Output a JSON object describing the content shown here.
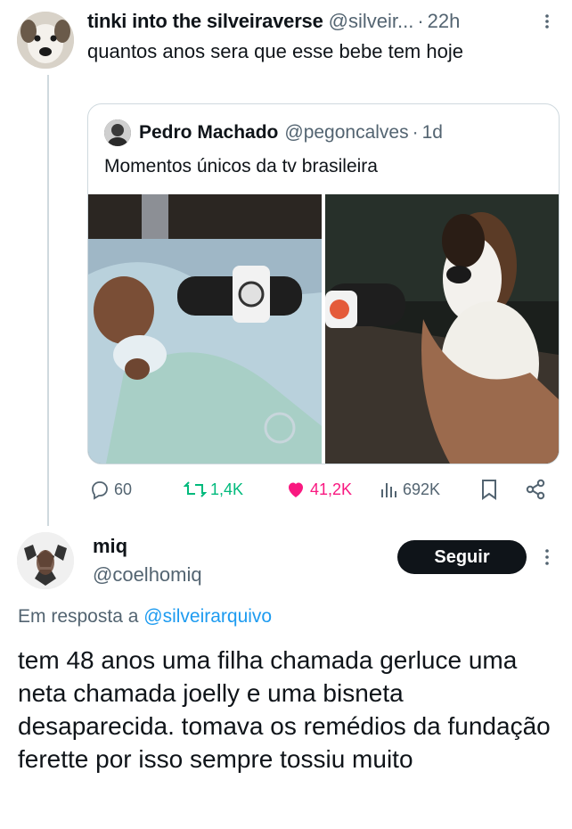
{
  "parent_tweet": {
    "display_name": "tinki into the silveiraverse",
    "handle": "@silveir...",
    "separator": "·",
    "time": "22h",
    "text": "quantos anos sera que esse bebe tem hoje",
    "quote": {
      "display_name": "Pedro Machado",
      "handle": "@pegoncalves",
      "separator": "·",
      "time": "1d",
      "text": "Momentos únicos da tv brasileira"
    },
    "actions": {
      "replies": "60",
      "reposts": "1,4K",
      "likes": "41,2K",
      "views": "692K"
    }
  },
  "reply_tweet": {
    "display_name": "miq",
    "handle": "@coelhomiq",
    "follow_label": "Seguir",
    "in_reply_prefix": "Em resposta a",
    "in_reply_handle": "@silveirarquivo",
    "text": "tem 48 anos uma filha chamada gerluce uma neta chamada joelly e uma bisneta desaparecida. tomava os remédios da fundação ferette por isso sempre tossiu muito"
  },
  "colors": {
    "text": "#0f1419",
    "secondary": "#536471",
    "link": "#1d9bf0",
    "repost_active": "#00ba7c",
    "like_active": "#f91880",
    "border": "#cfd9de",
    "follow_button": "#0f1419"
  },
  "icons": {
    "reply": "reply-icon",
    "repost": "repost-icon",
    "like": "heart-icon",
    "views": "views-icon",
    "bookmark": "bookmark-icon",
    "share": "share-icon",
    "more": "more-icon"
  }
}
